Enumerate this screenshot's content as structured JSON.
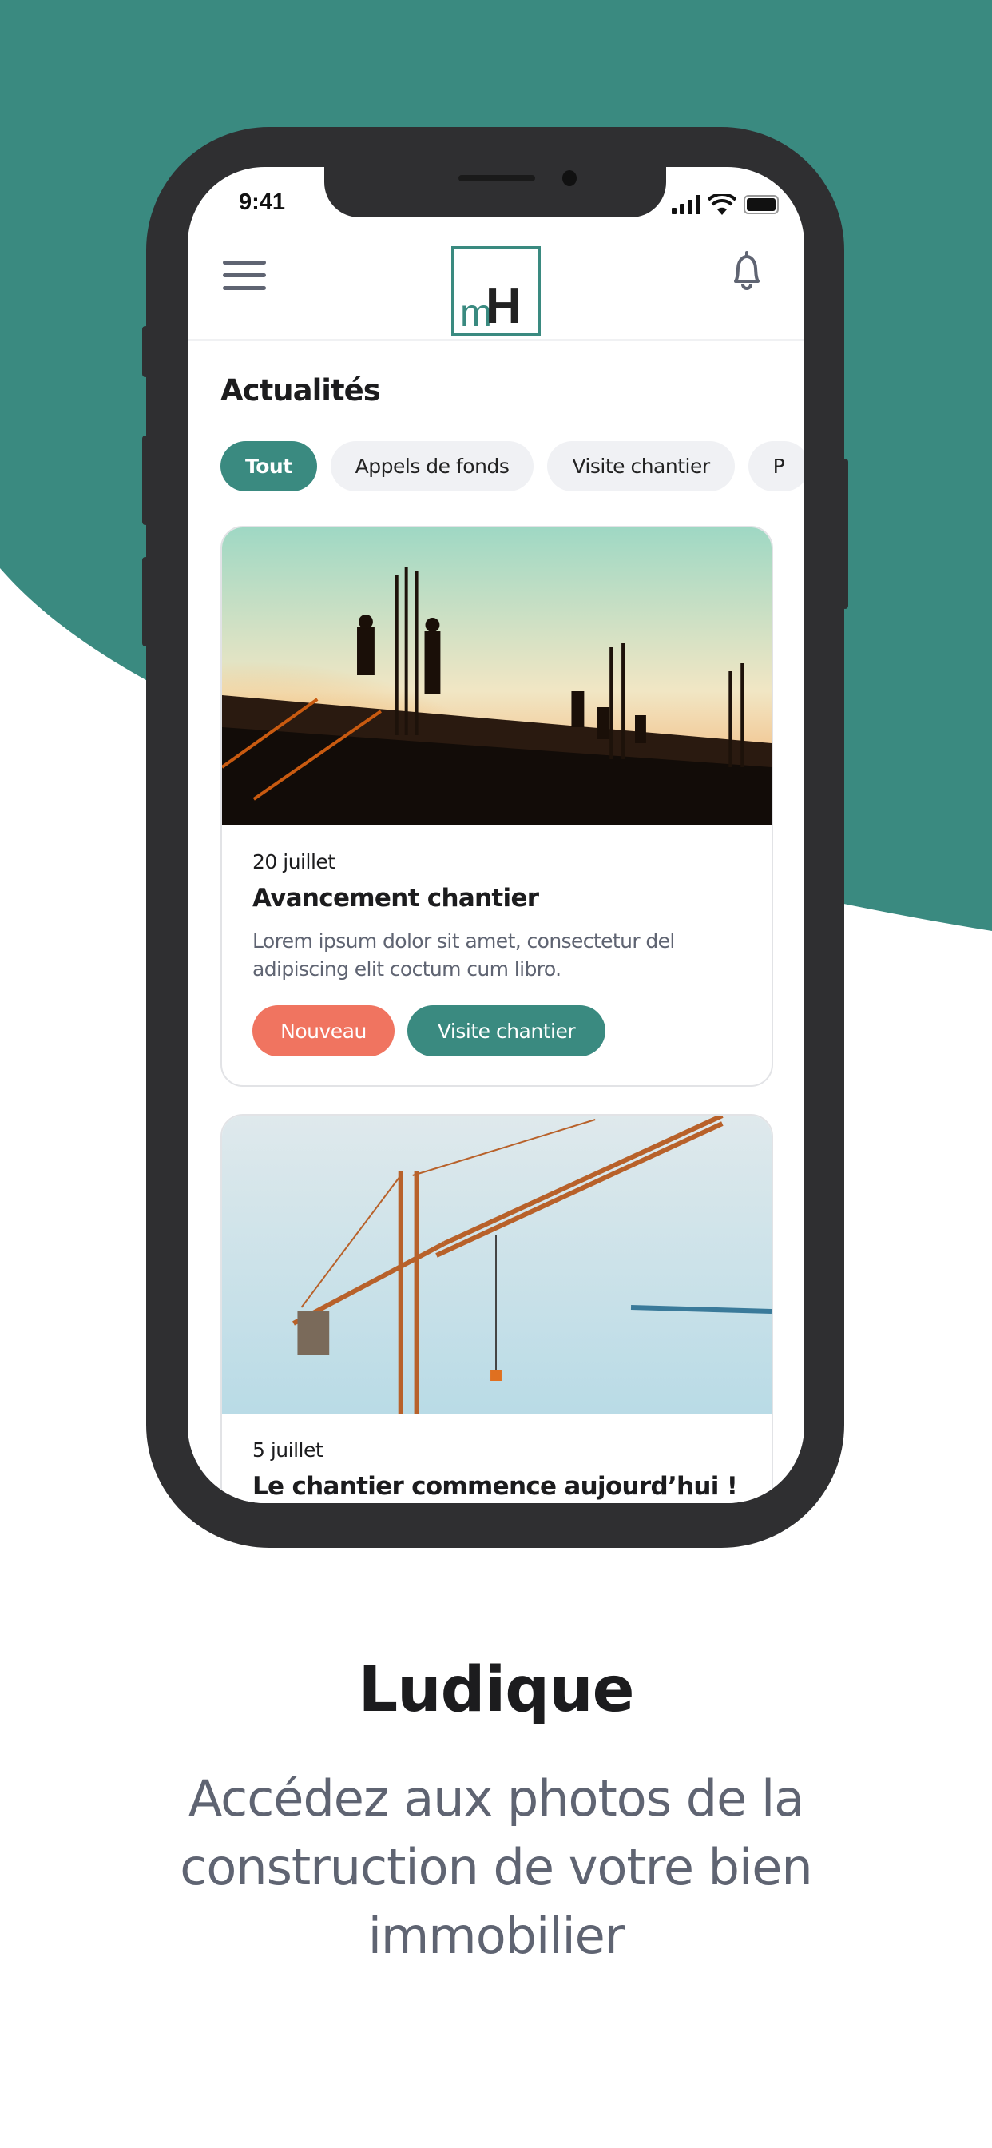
{
  "colors": {
    "brand": "#3a8a80",
    "accent": "#f07460",
    "frame": "#2f2f31",
    "muted": "#5f6472"
  },
  "status_bar": {
    "time": "9:41"
  },
  "header": {
    "menu_icon": "hamburger-icon",
    "logo_m": "m",
    "logo_h": "H",
    "notification_icon": "bell-icon"
  },
  "main": {
    "title": "Actualités",
    "filters": [
      {
        "label": "Tout",
        "active": true
      },
      {
        "label": "Appels de fonds"
      },
      {
        "label": "Visite chantier"
      },
      {
        "label": "P"
      }
    ],
    "cards": [
      {
        "date": "20 juillet",
        "title": "Avancement chantier",
        "description": "Lorem ipsum dolor sit amet, consectetur del adipiscing elit coctum cum libro.",
        "tags": [
          "Nouveau",
          "Visite chantier"
        ]
      },
      {
        "date": "5 juillet",
        "title": "Le chantier commence aujourd’hui !"
      }
    ]
  },
  "promo": {
    "title": "Ludique",
    "subtitle": "Accédez aux photos de la construction de votre bien immobilier"
  }
}
